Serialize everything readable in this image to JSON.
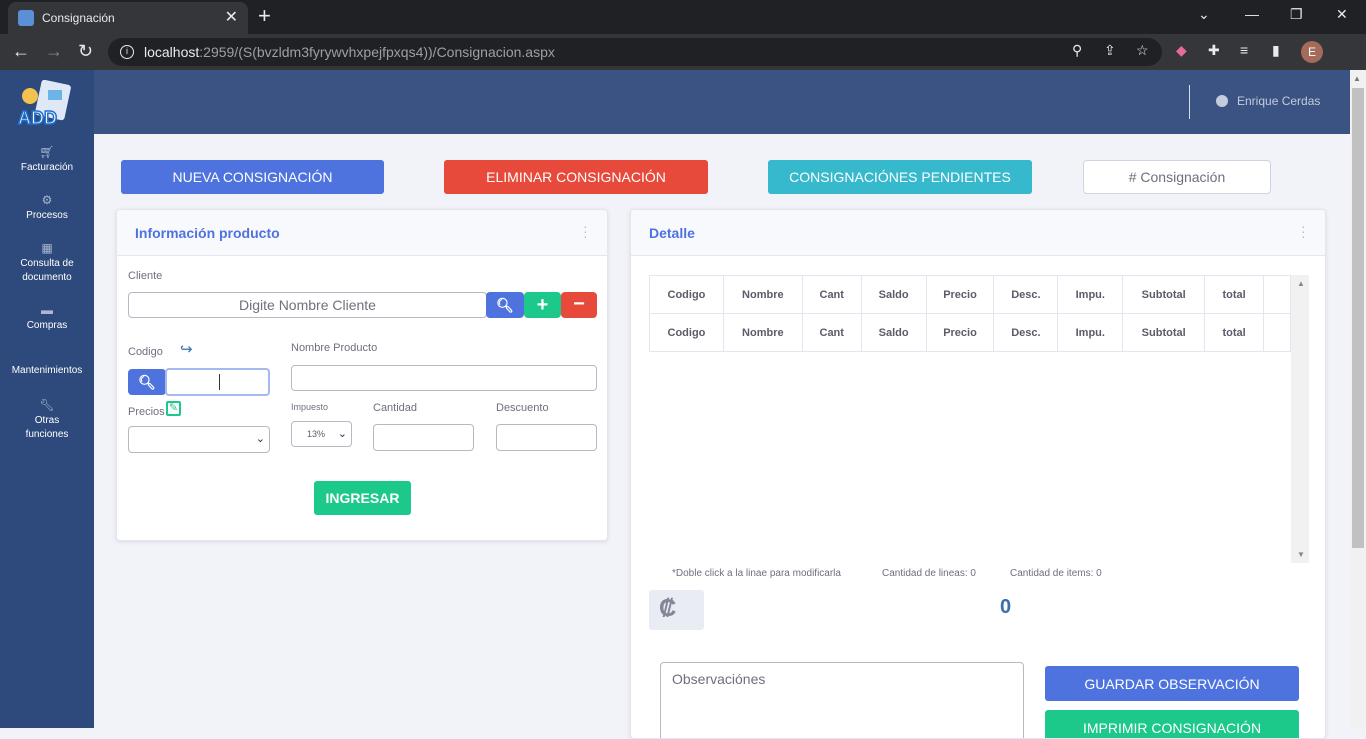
{
  "browser": {
    "tab_title": "Consignación",
    "url_host": "localhost",
    "url_path": ":2959/(S(bvzldm3fyrywvhxpejfpxqs4))/Consignacion.aspx",
    "avatar_letter": "E"
  },
  "sidebar": {
    "logo_text": "ADD",
    "items": [
      {
        "label": "Facturación",
        "icon": "cart-icon"
      },
      {
        "label": "Procesos",
        "icon": "gear-icon"
      },
      {
        "label": "Consulta de documento",
        "icon": "calendar-icon"
      },
      {
        "label": "Compras",
        "icon": "truck-icon"
      },
      {
        "label": "Mantenimientos",
        "icon": ""
      },
      {
        "label": "Otras funciones",
        "icon": "wrench-icon"
      }
    ]
  },
  "header": {
    "user_name": "Enrique Cerdas"
  },
  "actions": {
    "nueva": "NUEVA CONSIGNACIÓN",
    "eliminar": "ELIMINAR CONSIGNACIÓN",
    "pendientes": "CONSIGNACIÓNES PENDIENTES",
    "consig_placeholder": "# Consignación"
  },
  "producto": {
    "title": "Información producto",
    "cliente_label": "Cliente",
    "cliente_placeholder": "Digite Nombre Cliente",
    "codigo_label": "Codigo",
    "nombre_label": "Nombre Producto",
    "precios_label": "Precios",
    "impuesto_label": "Impuesto",
    "impuesto_value": "13%",
    "cantidad_label": "Cantidad",
    "descuento_label": "Descuento",
    "ingresar": "INGRESAR"
  },
  "detalle": {
    "title": "Detalle",
    "columns": [
      "Codigo",
      "Nombre",
      "Cant",
      "Saldo",
      "Precio",
      "Desc.",
      "Impu.",
      "Subtotal",
      "total"
    ],
    "hint": "*Doble click a la linae para modificarla",
    "lineas": "Cantidad de lineas: 0",
    "items": "Cantidad de items: 0",
    "currency": "₡",
    "total": "0",
    "obs_placeholder": "Observaciónes",
    "guardar": "GUARDAR OBSERVACIÓN",
    "imprimir": "IMPRIMIR CONSIGNACIÓN"
  },
  "colors": {
    "primary": "#4e73df",
    "danger": "#e74a3b",
    "info": "#36b9cc",
    "success": "#1cc88a",
    "sidebar": "#2e4a7c",
    "header": "#3a5383"
  }
}
